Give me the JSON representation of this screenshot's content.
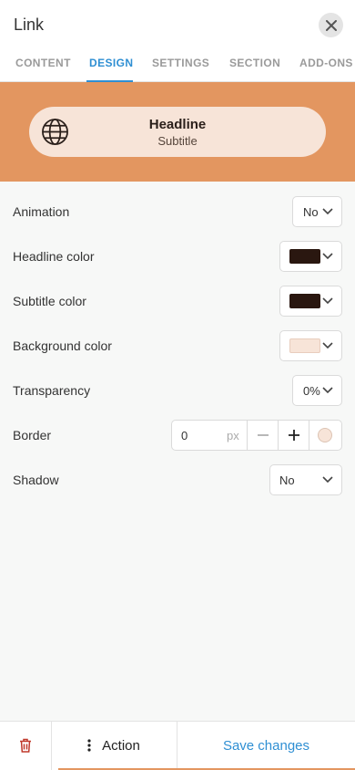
{
  "header": {
    "title": "Link",
    "close_icon": "close-icon"
  },
  "tabs": [
    {
      "label": "CONTENT",
      "active": false
    },
    {
      "label": "DESIGN",
      "active": true
    },
    {
      "label": "SETTINGS",
      "active": false
    },
    {
      "label": "SECTION",
      "active": false
    },
    {
      "label": "ADD-ONS",
      "active": false
    }
  ],
  "preview": {
    "background": "#e39660",
    "pill_background": "#f7e4d8",
    "icon": "globe-icon",
    "headline": "Headline",
    "subtitle": "Subtitle"
  },
  "settings": {
    "animation": {
      "label": "Animation",
      "value": "No"
    },
    "headline_color": {
      "label": "Headline color",
      "color": "#2a1710"
    },
    "subtitle_color": {
      "label": "Subtitle color",
      "color": "#2a1710"
    },
    "background_color": {
      "label": "Background color",
      "color": "#f7e4d8"
    },
    "transparency": {
      "label": "Transparency",
      "value": "0%"
    },
    "border": {
      "label": "Border",
      "value": "0",
      "unit": "px",
      "color": "#f7e4d8"
    },
    "shadow": {
      "label": "Shadow",
      "value": "No"
    }
  },
  "footer": {
    "delete_icon": "trash-icon",
    "action_label": "Action",
    "save_label": "Save changes"
  },
  "colors": {
    "accent": "#2f8fd3",
    "danger": "#c0392b"
  }
}
